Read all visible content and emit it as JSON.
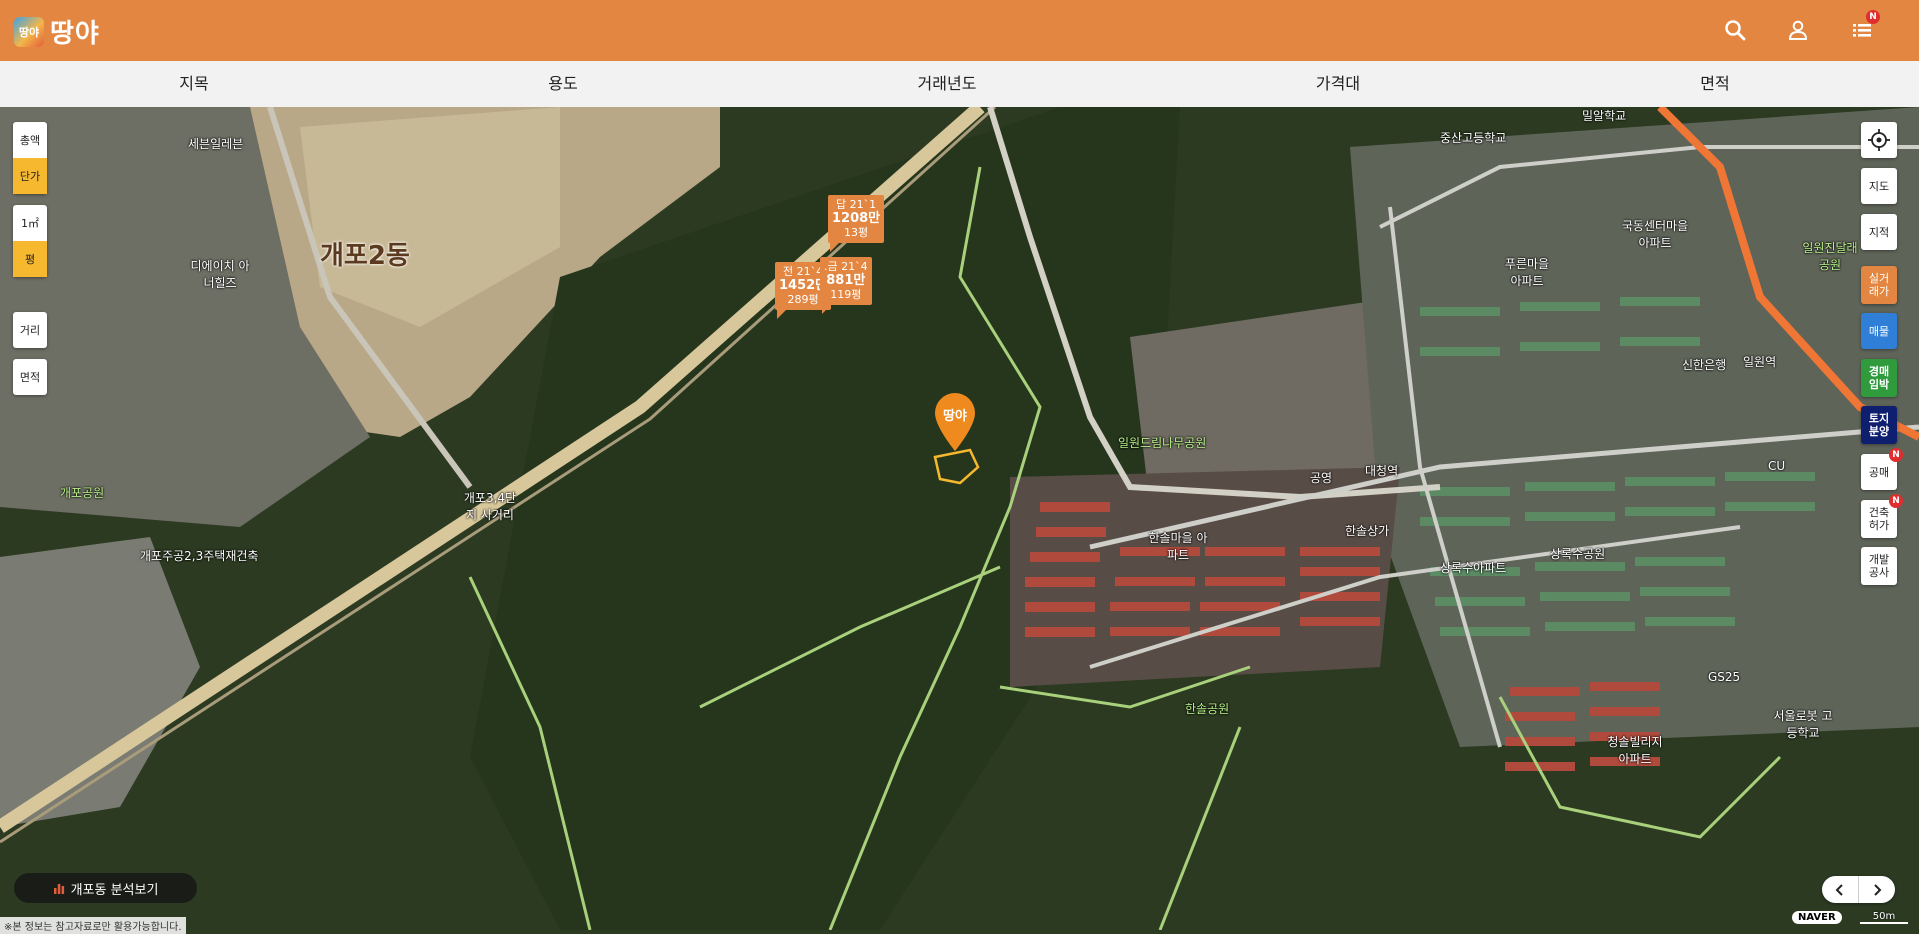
{
  "header": {
    "logo_mark": "땅야",
    "logo_text": "땅야",
    "notification_badge": "N",
    "bg_color": "#e38641"
  },
  "filters": [
    "지목",
    "용도",
    "거래년도",
    "가격대",
    "면적"
  ],
  "left_controls": {
    "price_mode": [
      "총액",
      "단가"
    ],
    "unit_mode": [
      "1㎡",
      "평"
    ],
    "distance": "거리",
    "area": "면적",
    "active": [
      "단가",
      "평"
    ]
  },
  "right_controls": {
    "location_icon": "crosshair-icon",
    "map": "지도",
    "cadastral": "지적",
    "actual_price": "실거래가",
    "listing": "매물",
    "auction": "경매임박",
    "land_sale": "토지분양",
    "public_sale": "공매",
    "building_permit": "건축허가",
    "development": "개발공사",
    "badge": "N"
  },
  "price_tags": [
    {
      "line1": "답 21`1",
      "price": "1208만",
      "area": "13평"
    },
    {
      "line1": "전 21`4",
      "price": "1452만",
      "area": "289평"
    },
    {
      "line1": ".금 21`4",
      "price": "881만",
      "area": "119평"
    }
  ],
  "pin_label": "땅야",
  "map_labels": {
    "district": "개포2동",
    "selpeu": "세븐일레븐",
    "dh": "디에이치 아너힐즈",
    "gaepo_park": "개포공원",
    "gaepo_jugong": "개포주공2,3주택재건축",
    "junction": "개포3,4단지 사거리",
    "ilwon_park": "일원드림나무공원",
    "hansol_maeul": "한솔마을 아파트",
    "hansol_sangga": "한솔상가",
    "hansol_park": "한솔공원",
    "sangnoksu": "상록수아파트",
    "sangnoksu_park": "상록수공원",
    "cheongsol": "청솔빌리지 아파트",
    "gs25": "GS25",
    "seoul_robot": "서울로봇 고등학교",
    "jungsan_high": "중산고등학교",
    "milal": "밀알학교",
    "pureun": "푸른마을 아파트",
    "gukdong": "국동센터마을 아파트",
    "ilwon_station": "일원역",
    "shinhan": "신한은행",
    "cu": "CU",
    "gongyeong": "공영",
    "daecheong": "대청역",
    "ilwon_jindal": "일원진달래 공원"
  },
  "analysis_button": "개포동 분석보기",
  "scale": "50m",
  "naver": "NAVER",
  "disclaimer": "※본 정보는 참고자료로만 활용가능합니다."
}
